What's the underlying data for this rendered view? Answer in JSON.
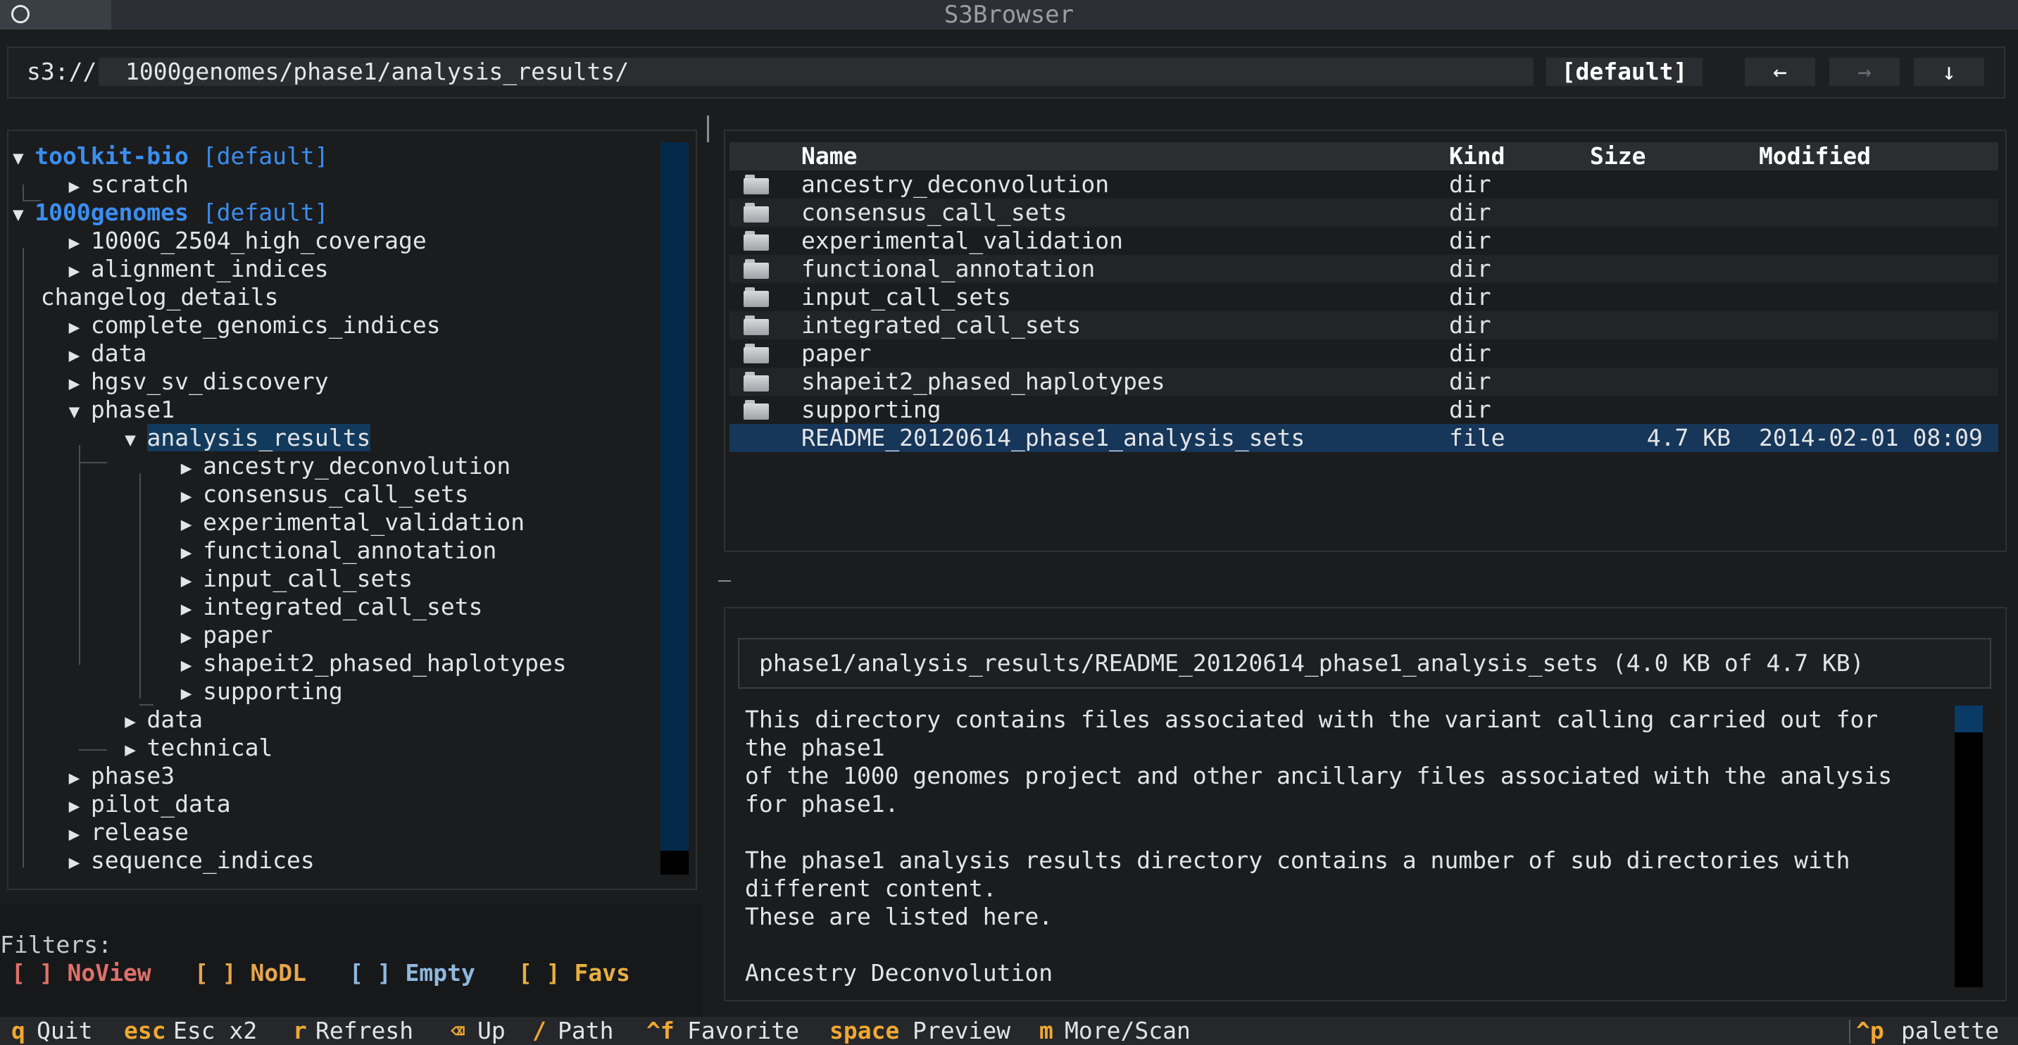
{
  "window": {
    "title": "S3Browser"
  },
  "pathbar": {
    "scheme": "s3://",
    "path": "1000genomes/phase1/analysis_results/",
    "profile": "[default]",
    "back": "←",
    "forward": "→",
    "download": "↓"
  },
  "tree": {
    "roots": [
      {
        "name": "toolkit-bio",
        "tag": "[default]"
      },
      {
        "name": "1000genomes",
        "tag": "[default]"
      }
    ],
    "nodes": [
      "scratch",
      "1000G_2504_high_coverage",
      "alignment_indices",
      "changelog_details",
      "complete_genomics_indices",
      "data",
      "hgsv_sv_discovery",
      "phase1",
      "analysis_results",
      "ancestry_deconvolution",
      "consensus_call_sets",
      "experimental_validation",
      "functional_annotation",
      "input_call_sets",
      "integrated_call_sets",
      "paper",
      "shapeit2_phased_haplotypes",
      "supporting",
      "data",
      "technical",
      "phase3",
      "pilot_data",
      "release",
      "sequence_indices"
    ],
    "expanded_marker": "▼",
    "collapsed_marker": "▶"
  },
  "list": {
    "headers": {
      "name": "Name",
      "kind": "Kind",
      "size": "Size",
      "modified": "Modified"
    },
    "rows": [
      {
        "name": "ancestry_deconvolution",
        "kind": "dir",
        "size": "",
        "modified": ""
      },
      {
        "name": "consensus_call_sets",
        "kind": "dir",
        "size": "",
        "modified": ""
      },
      {
        "name": "experimental_validation",
        "kind": "dir",
        "size": "",
        "modified": ""
      },
      {
        "name": "functional_annotation",
        "kind": "dir",
        "size": "",
        "modified": ""
      },
      {
        "name": "input_call_sets",
        "kind": "dir",
        "size": "",
        "modified": ""
      },
      {
        "name": "integrated_call_sets",
        "kind": "dir",
        "size": "",
        "modified": ""
      },
      {
        "name": "paper",
        "kind": "dir",
        "size": "",
        "modified": ""
      },
      {
        "name": "shapeit2_phased_haplotypes",
        "kind": "dir",
        "size": "",
        "modified": ""
      },
      {
        "name": "supporting",
        "kind": "dir",
        "size": "",
        "modified": ""
      },
      {
        "name": "README_20120614_phase1_analysis_sets",
        "kind": "file",
        "size": "4.7 KB",
        "modified": "2014-02-01 08:09"
      }
    ]
  },
  "preview": {
    "title": "phase1/analysis_results/README_20120614_phase1_analysis_sets (4.0 KB of 4.7 KB)",
    "lines": [
      "This directory contains files associated with the variant calling carried out for",
      "the phase1",
      "of the 1000 genomes project and other ancillary files associated with the analysis",
      "for phase1.",
      "",
      "The phase1 analysis results directory contains a number of sub directories with",
      "different content.",
      "These are listed here.",
      "",
      "Ancestry Deconvolution"
    ]
  },
  "filters": {
    "label": "Filters:",
    "items": [
      {
        "text": "[ ] NoView",
        "color": "#e0706a"
      },
      {
        "text": "[ ] NoDL",
        "color": "#e8a64c"
      },
      {
        "text": "[ ] Empty",
        "color": "#8fb8e0"
      },
      {
        "text": "[ ] Favs",
        "color": "#e8b040"
      }
    ]
  },
  "statusbar": {
    "items": [
      {
        "key": "q",
        "label": "Quit"
      },
      {
        "key": "esc",
        "label": "Esc x2"
      },
      {
        "key": "r",
        "label": "Refresh"
      },
      {
        "key": "⌫",
        "label": "Up"
      },
      {
        "key": "/",
        "label": "Path"
      },
      {
        "key": "^f",
        "label": "Favorite"
      },
      {
        "key": "space",
        "label": "Preview"
      },
      {
        "key": "m",
        "label": "More/Scan"
      }
    ],
    "palette_key": "^p",
    "palette_label": "palette"
  },
  "colors": {
    "accent": "#3b8ef0",
    "key": "#f0a830",
    "selection": "#16365a"
  }
}
